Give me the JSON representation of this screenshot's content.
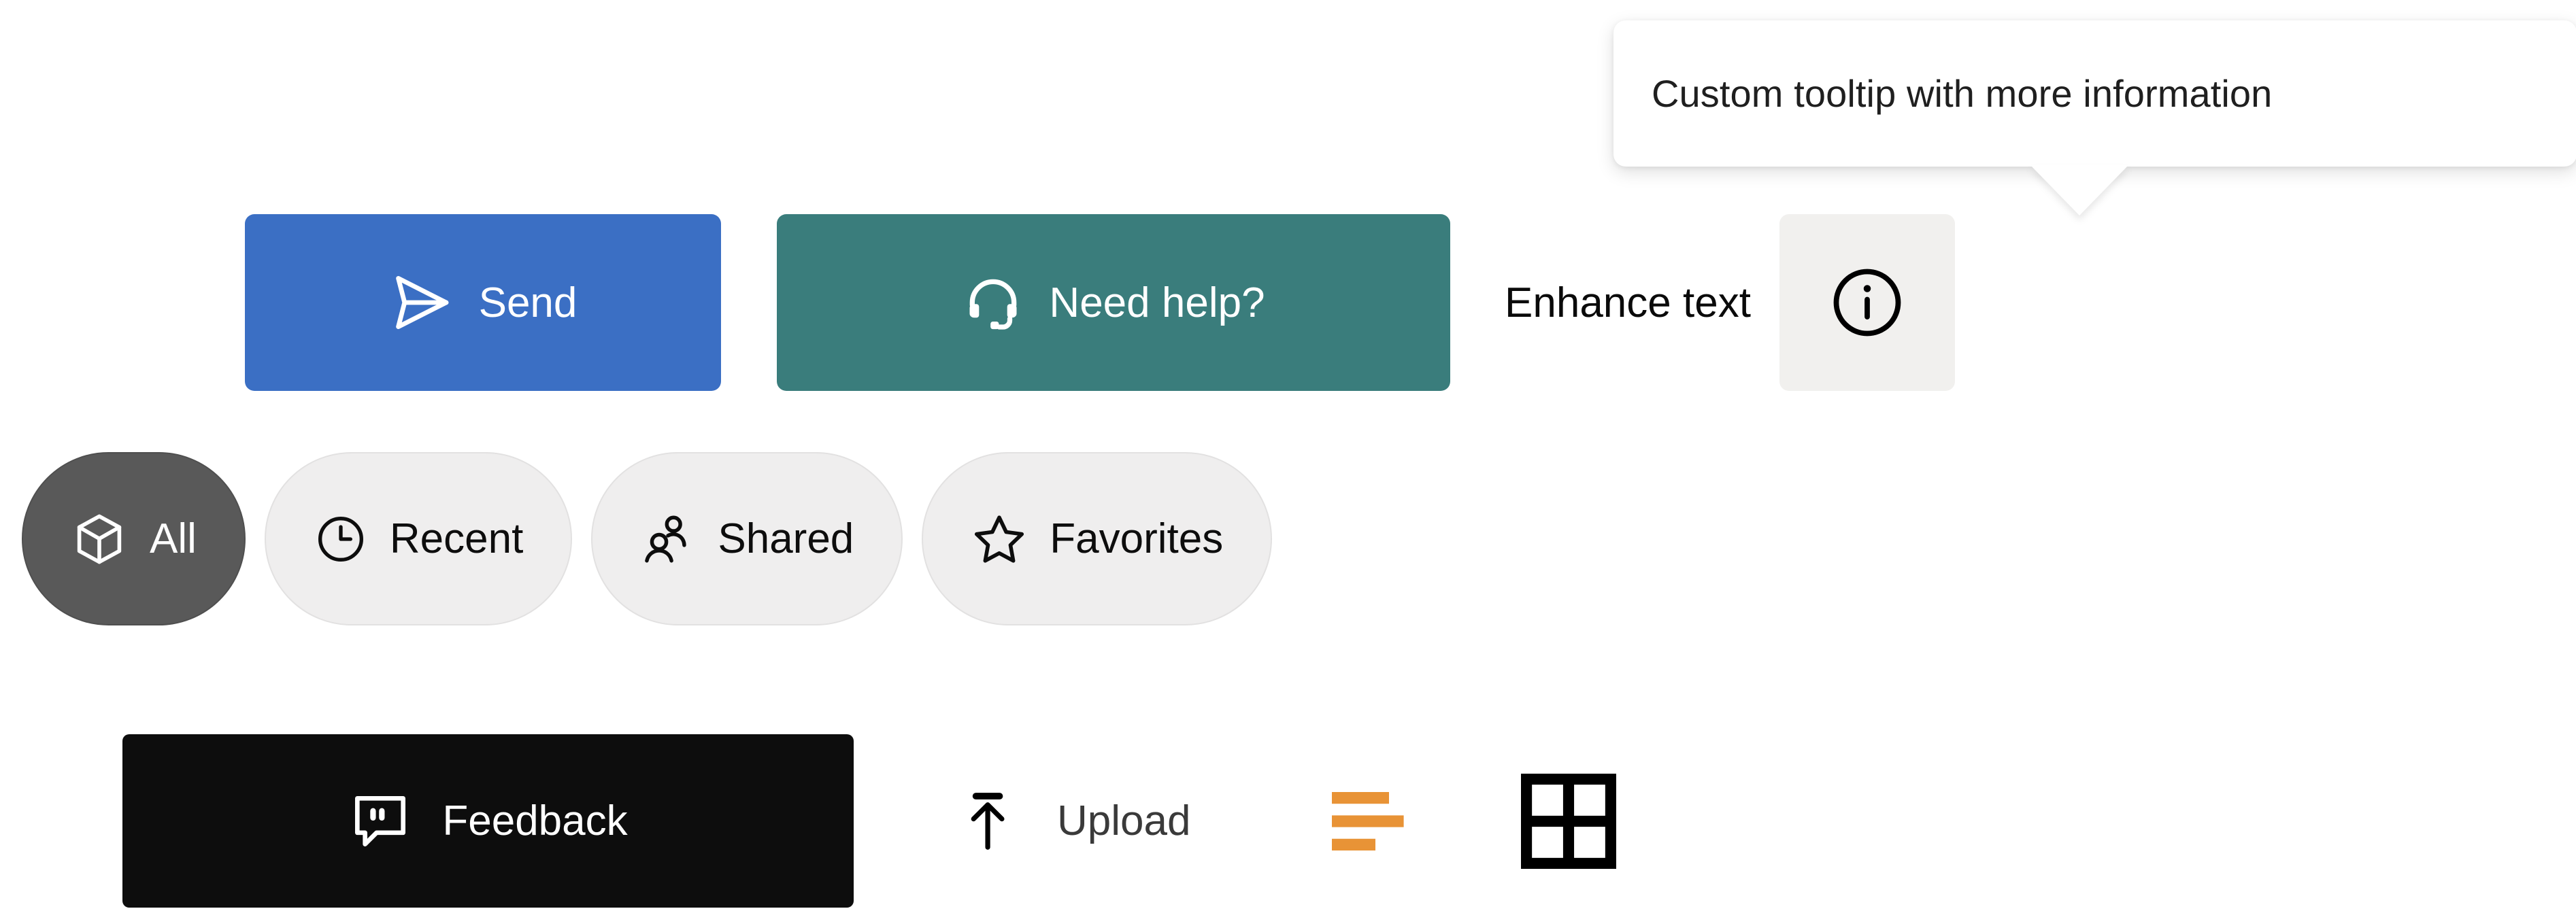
{
  "tooltip": {
    "text": "Custom tooltip with more information",
    "background": "#ffffff",
    "text_color": "#1f1f1f",
    "pointer": "down"
  },
  "actions": {
    "send": {
      "label": "Send",
      "icon": "send-icon",
      "background": "#3b6fc4",
      "text_color": "#ffffff"
    },
    "help": {
      "label": "Need help?",
      "icon": "headset-icon",
      "background": "#3a7d7c",
      "text_color": "#ffffff"
    },
    "enhance_label": "Enhance text",
    "info": {
      "icon": "info-circle-icon",
      "background": "#f1f0ee",
      "icon_color": "#000000"
    }
  },
  "chips": [
    {
      "label": "All",
      "icon": "cube-icon",
      "selected": true,
      "background": "#595959",
      "text_color": "#ffffff"
    },
    {
      "label": "Recent",
      "icon": "clock-icon",
      "selected": false,
      "background": "#efeeee",
      "text_color": "#0d0d0d"
    },
    {
      "label": "Shared",
      "icon": "people-icon",
      "selected": false,
      "background": "#efeeee",
      "text_color": "#0d0d0d"
    },
    {
      "label": "Favorites",
      "icon": "star-icon",
      "selected": false,
      "background": "#efeeee",
      "text_color": "#0d0d0d"
    }
  ],
  "footer": {
    "feedback": {
      "label": "Feedback",
      "icon": "comment-quote-icon",
      "background": "#0d0d0d",
      "text_color": "#ffffff"
    },
    "upload": {
      "label": "Upload",
      "icon": "arrow-up-to-line-icon",
      "text_color": "#3a3a3a"
    },
    "lines": {
      "icon": "text-align-lines-icon",
      "color": "#e89336"
    },
    "grid": {
      "icon": "grid-2x2-icon",
      "color": "#000000"
    }
  }
}
